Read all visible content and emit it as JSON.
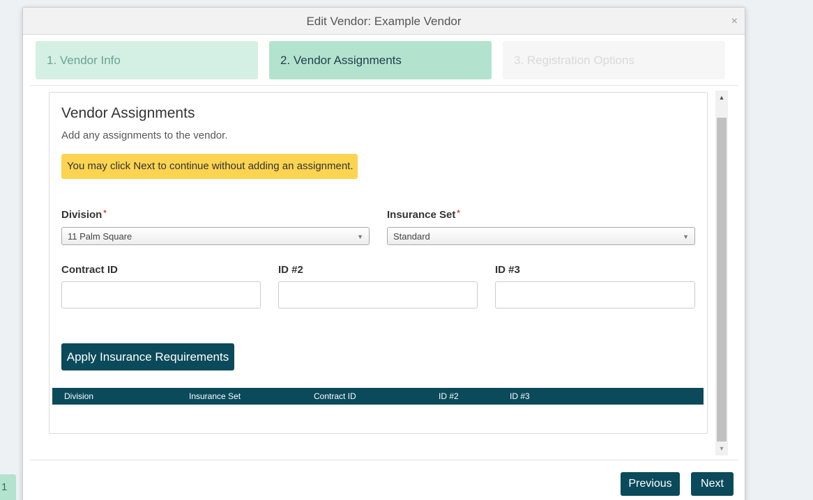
{
  "background": {
    "chip_label": "1"
  },
  "dialog": {
    "title": "Edit Vendor: Example Vendor",
    "close_glyph": "×"
  },
  "steps": [
    {
      "label": "1. Vendor Info",
      "state": "completed"
    },
    {
      "label": "2. Vendor Assignments",
      "state": "active"
    },
    {
      "label": "3. Registration Options",
      "state": "disabled"
    }
  ],
  "section": {
    "title": "Vendor Assignments",
    "subtitle": "Add any assignments to the vendor.",
    "notice": "You may click Next to continue without adding an assignment."
  },
  "form": {
    "division": {
      "label": "Division",
      "required_marker": "*",
      "value": "11 Palm Square"
    },
    "insurance_set": {
      "label": "Insurance Set",
      "required_marker": "*",
      "value": "Standard"
    },
    "contract_id": {
      "label": "Contract ID",
      "value": ""
    },
    "id2": {
      "label": "ID #2",
      "value": ""
    },
    "id3": {
      "label": "ID #3",
      "value": ""
    },
    "dropdown_arrow": "▼"
  },
  "actions": {
    "apply": "Apply Insurance Requirements"
  },
  "table": {
    "columns": [
      "Division",
      "Insurance Set",
      "Contract ID",
      "ID #2",
      "ID #3"
    ],
    "rows": []
  },
  "scrollbar": {
    "up": "▲",
    "down": "▼"
  },
  "footer": {
    "previous": "Previous",
    "next": "Next"
  },
  "colors": {
    "accent_dark": "#0b4a5b",
    "step_active": "#b3e3cf",
    "step_completed": "#d4f0e5",
    "notice_bg": "#fdd451",
    "required": "#d0312d"
  }
}
